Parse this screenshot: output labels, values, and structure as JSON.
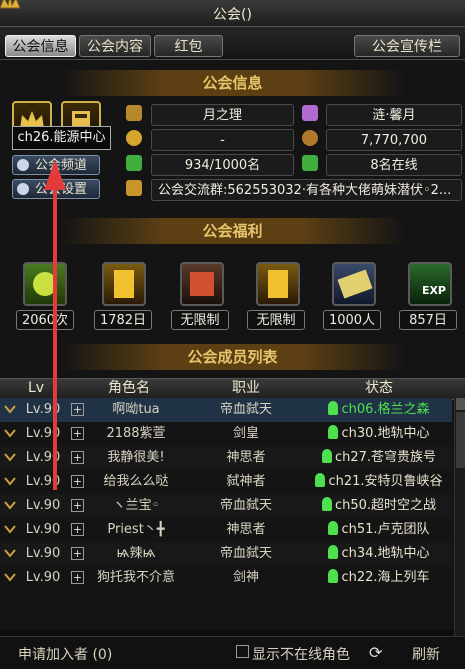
{
  "window": {
    "title": "公会()"
  },
  "tabs": [
    {
      "label": "公会信息",
      "active": true
    },
    {
      "label": "公会内容",
      "active": false
    },
    {
      "label": "红包",
      "active": false
    }
  ],
  "promo_tab": {
    "label": "公会宣传栏"
  },
  "guild_info": {
    "section_title": "公会信息",
    "guild_name": "月之理",
    "leader": "涟·馨月",
    "rank": "-",
    "funds": "7,770,700",
    "members": "934/1000名",
    "online": "8名在线",
    "notice": "公会交流群:562553032·有各种大佬萌妹潜伏◦2...",
    "tooltip": "ch26.能源中心",
    "channel_button": "公会频道",
    "settings_button": "公会设置"
  },
  "welfare": {
    "section_title": "公会福利",
    "items": [
      {
        "icon": "power-orb-icon",
        "label": "2060次"
      },
      {
        "icon": "gold-golem-icon",
        "label": "1782日"
      },
      {
        "icon": "hourglass-book-icon",
        "label": "无限制"
      },
      {
        "icon": "gold-golem-icon",
        "label": "无限制"
      },
      {
        "icon": "sword-shield-icon",
        "label": "1000人"
      },
      {
        "icon": "exp-up-icon",
        "label": "857日"
      }
    ]
  },
  "members": {
    "section_title": "公会成员列表",
    "columns": [
      "Lv",
      "角色名",
      "职业",
      "状态"
    ],
    "rows": [
      {
        "lv": "Lv.90",
        "name": "啊呦tua",
        "job": "帝血弑天",
        "status": "ch06.格兰之森",
        "highlight": true
      },
      {
        "lv": "Lv.90",
        "name": "2188紫萱",
        "job": "剑皇",
        "status": "ch30.地轨中心",
        "highlight": false
      },
      {
        "lv": "Lv.90",
        "name": "我静很美!",
        "job": "神思者",
        "status": "ch27.苍穹贵族号",
        "highlight": false
      },
      {
        "lv": "Lv.90",
        "name": "给我么么哒",
        "job": "弑神者",
        "status": "ch21.安特贝鲁峡谷",
        "highlight": false
      },
      {
        "lv": "Lv.90",
        "name": "ヽ兰宝◦",
        "job": "帝血弑天",
        "status": "ch50.超时空之战",
        "highlight": false
      },
      {
        "lv": "Lv.90",
        "name": "Priest丶╋",
        "job": "神思者",
        "status": "ch51.卢克团队",
        "highlight": false
      },
      {
        "lv": "Lv.90",
        "name": "ѩ辣ѩ",
        "job": "帝血弑天",
        "status": "ch34.地轨中心",
        "highlight": false
      },
      {
        "lv": "Lv.90",
        "name": "狗托我不介意",
        "job": "剑神",
        "status": "ch22.海上列车",
        "highlight": false
      }
    ]
  },
  "footer": {
    "applicants": "申请加入者 (0)",
    "hide_offline": "显示不在线角色",
    "refresh": "刷新"
  },
  "colors": {
    "accent": "#e8c46a",
    "highlight_row": "#1f3246",
    "status_green": "#4fe04f"
  }
}
